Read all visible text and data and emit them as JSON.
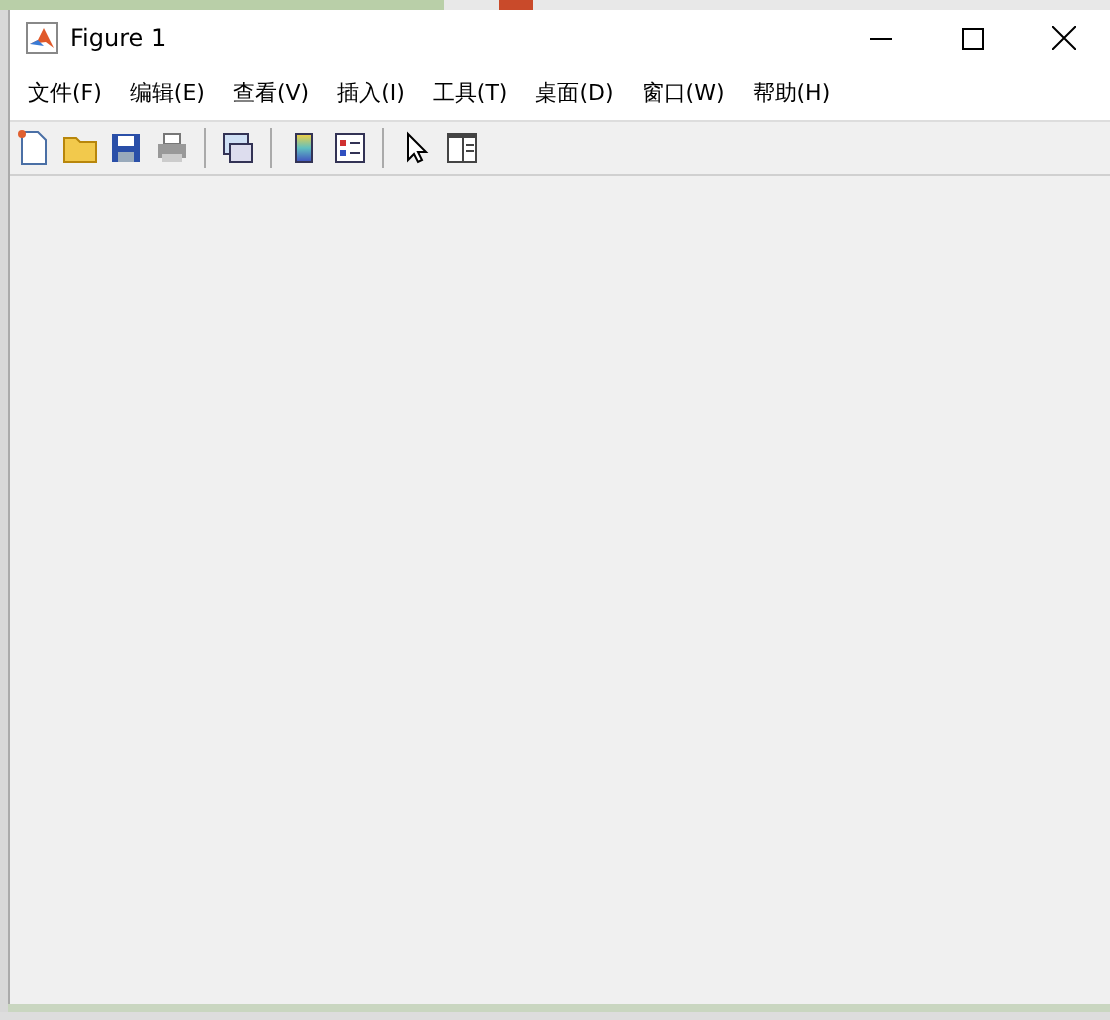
{
  "window": {
    "title": "Figure 1"
  },
  "menu": [
    {
      "label": "文件(F)"
    },
    {
      "label": "编辑(E)"
    },
    {
      "label": "查看(V)"
    },
    {
      "label": "插入(I)"
    },
    {
      "label": "工具(T)"
    },
    {
      "label": "桌面(D)"
    },
    {
      "label": "窗口(W)"
    },
    {
      "label": "帮助(H)"
    }
  ],
  "toolbar": [
    {
      "kind": "new"
    },
    {
      "kind": "open"
    },
    {
      "kind": "save"
    },
    {
      "kind": "print"
    },
    {
      "kind": "separator"
    },
    {
      "kind": "link"
    },
    {
      "kind": "separator"
    },
    {
      "kind": "colorbar"
    },
    {
      "kind": "legend"
    },
    {
      "kind": "separator"
    },
    {
      "kind": "pointer"
    },
    {
      "kind": "panel"
    }
  ]
}
